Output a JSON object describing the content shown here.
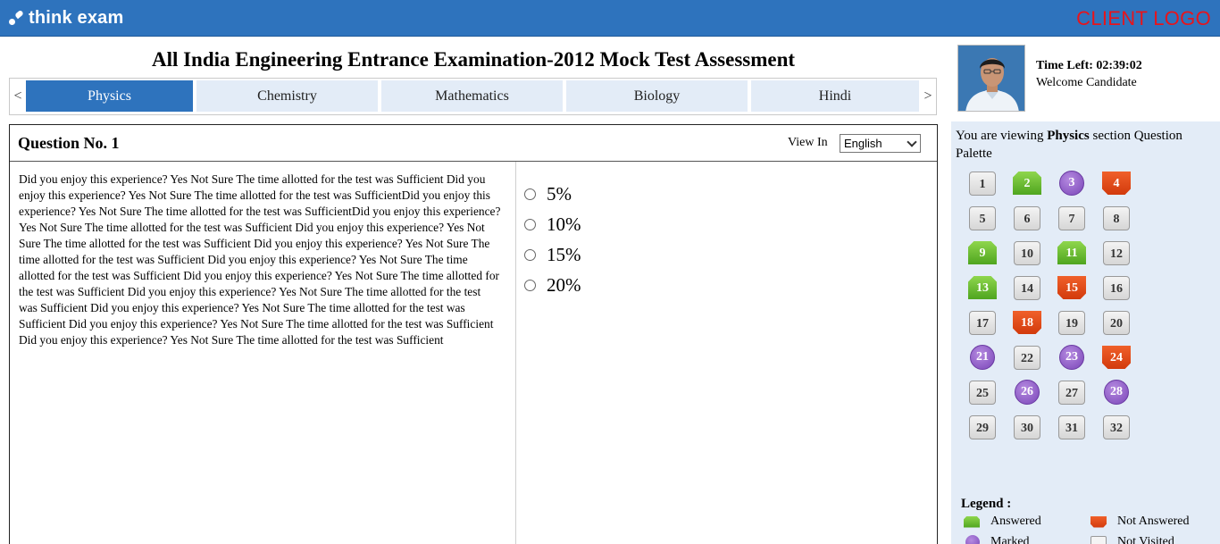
{
  "header": {
    "brand": "think exam",
    "client_logo": "CLIENT LOGO"
  },
  "exam": {
    "title": "All India Engineering Entrance Examination-2012 Mock Test Assessment"
  },
  "tabs": {
    "prev": "<",
    "next": ">",
    "items": [
      {
        "label": "Physics",
        "active": true
      },
      {
        "label": "Chemistry",
        "active": false
      },
      {
        "label": "Mathematics",
        "active": false
      },
      {
        "label": "Biology",
        "active": false
      },
      {
        "label": "Hindi",
        "active": false
      }
    ]
  },
  "question": {
    "number_label": "Question No. 1",
    "view_in_label": "View In",
    "language": "English",
    "text": "Did you enjoy this experience? Yes Not Sure The time allotted for the test was Sufficient Did you enjoy this experience? Yes Not Sure The time allotted for the test was SufficientDid you enjoy this experience? Yes Not Sure The time allotted for the test was SufficientDid you enjoy this experience? Yes Not Sure The time allotted for the test was Sufficient Did you enjoy this experience? Yes Not Sure The time allotted for the test was Sufficient Did you enjoy this experience? Yes Not Sure The time allotted for the test was Sufficient Did you enjoy this experience? Yes Not Sure The time allotted for the test was Sufficient Did you enjoy this experience? Yes Not Sure The time allotted for the test was Sufficient Did you enjoy this experience? Yes Not Sure The time allotted for the test was Sufficient Did you enjoy this experience? Yes Not Sure The time allotted for the test was Sufficient Did you enjoy this experience? Yes Not Sure The time allotted for the test was Sufficient Did you enjoy this experience? Yes Not Sure The time allotted for the test was Sufficient",
    "options": [
      "5%",
      "10%",
      "15%",
      "20%"
    ]
  },
  "candidate": {
    "time_left": "Time Left: 02:39:02",
    "welcome": "Welcome Candidate"
  },
  "palette": {
    "title_prefix": "You are viewing ",
    "section": "Physics",
    "title_suffix": " section Question Palette",
    "questions": [
      {
        "n": "1",
        "status": "nv"
      },
      {
        "n": "2",
        "status": "ans"
      },
      {
        "n": "3",
        "status": "mk"
      },
      {
        "n": "4",
        "status": "na"
      },
      {
        "n": "5",
        "status": "nv"
      },
      {
        "n": "6",
        "status": "nv"
      },
      {
        "n": "7",
        "status": "nv"
      },
      {
        "n": "8",
        "status": "nv"
      },
      {
        "n": "9",
        "status": "ans"
      },
      {
        "n": "10",
        "status": "nv"
      },
      {
        "n": "11",
        "status": "ans"
      },
      {
        "n": "12",
        "status": "nv"
      },
      {
        "n": "13",
        "status": "ans"
      },
      {
        "n": "14",
        "status": "nv"
      },
      {
        "n": "15",
        "status": "na"
      },
      {
        "n": "16",
        "status": "nv"
      },
      {
        "n": "17",
        "status": "nv"
      },
      {
        "n": "18",
        "status": "na"
      },
      {
        "n": "19",
        "status": "nv"
      },
      {
        "n": "20",
        "status": "nv"
      },
      {
        "n": "21",
        "status": "mk"
      },
      {
        "n": "22",
        "status": "nv"
      },
      {
        "n": "23",
        "status": "mk"
      },
      {
        "n": "24",
        "status": "na"
      },
      {
        "n": "25",
        "status": "nv"
      },
      {
        "n": "26",
        "status": "mk"
      },
      {
        "n": "27",
        "status": "nv"
      },
      {
        "n": "28",
        "status": "mk"
      },
      {
        "n": "29",
        "status": "nv"
      },
      {
        "n": "30",
        "status": "nv"
      },
      {
        "n": "31",
        "status": "nv"
      },
      {
        "n": "32",
        "status": "nv"
      }
    ]
  },
  "legend": {
    "title": "Legend :",
    "answered": "Answered",
    "not_answered": "Not Answered",
    "marked": "Marked",
    "not_visited": "Not Visited"
  },
  "colors": {
    "brand_blue": "#2e73bd",
    "client_logo_red": "#e8141b",
    "answered_green": "#5fb42a",
    "not_answered_orange": "#e0461a",
    "marked_purple": "#8a55c8",
    "palette_bg": "#e3ecf7"
  }
}
